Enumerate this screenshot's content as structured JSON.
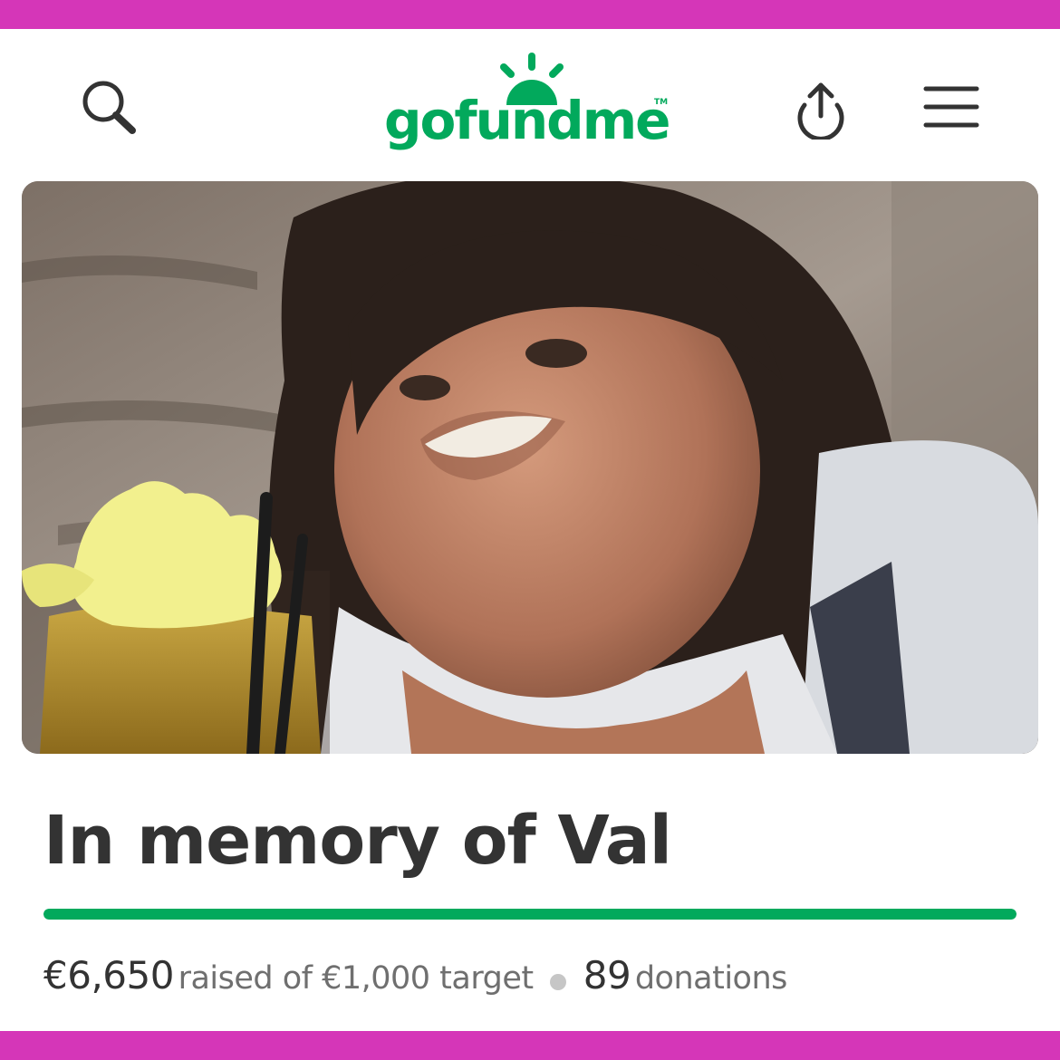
{
  "header": {
    "logo_text": "gofundme",
    "logo_trademark": "TM",
    "icons": {
      "search": "search-icon",
      "share": "share-icon",
      "menu": "menu-icon"
    }
  },
  "fundraiser": {
    "title": "In memory of Val",
    "raised": "€6,650",
    "raised_suffix": "raised of €1,000 target",
    "donations_count": "89",
    "donations_label": "donations",
    "progress_percent": 100
  },
  "colors": {
    "brand_green": "#02a95c",
    "frame_magenta": "#d536b8",
    "title_text": "#333333",
    "muted_text": "#6f6f6f"
  }
}
